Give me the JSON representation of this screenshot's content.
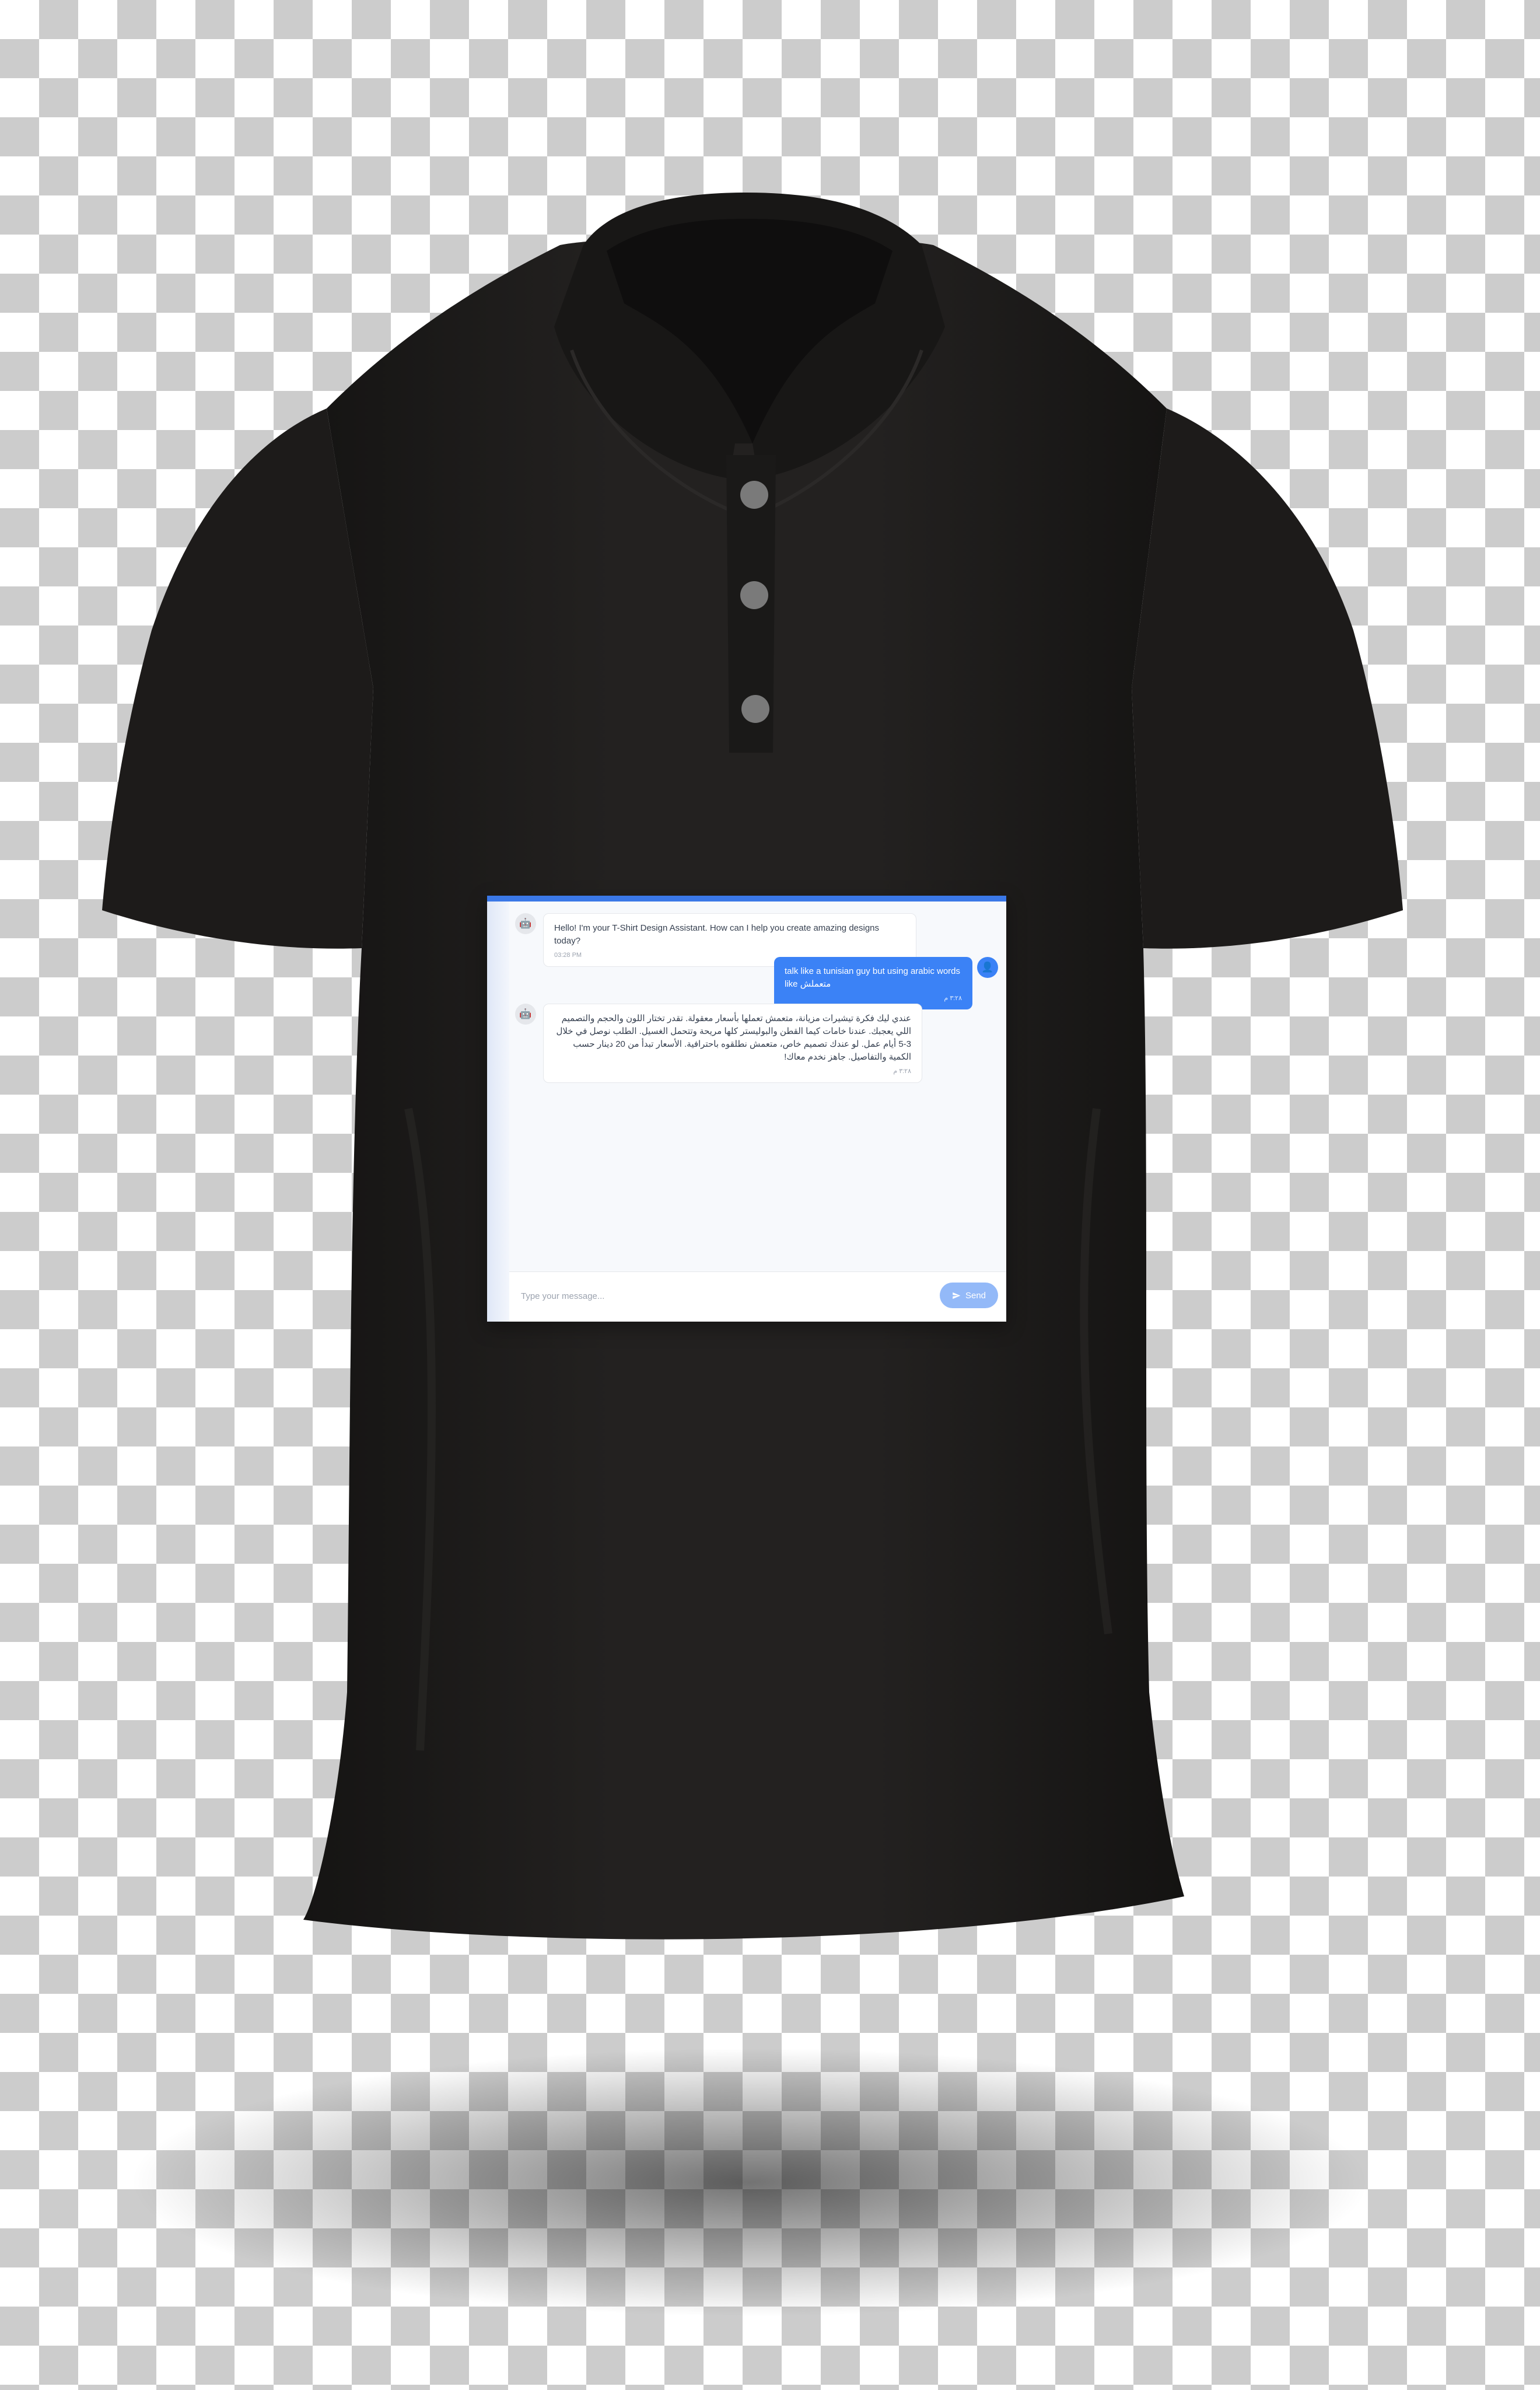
{
  "chat": {
    "messages": [
      {
        "sender": "bot",
        "text": "Hello! I'm your T-Shirt Design Assistant. How can I help you create amazing designs today?",
        "time": "03:28 PM"
      },
      {
        "sender": "user",
        "text": "talk like a tunisian guy but using arabic words like متعملش",
        "time": "٣:٢٨ م"
      },
      {
        "sender": "bot",
        "text": "عندي ليك فكرة تيشيرات مزيانة، متعمش تعملها بأسعار معقولة. تقدر تختار اللون والحجم والتصميم اللي يعجبك. عندنا خامات كيما القطن والبوليستر كلها مريحة وتتحمل الغسيل. الطلب نوصل في خلال 3-5 أيام عمل. لو عندك تصميم خاص، متعمش نطلقوه باحترافية. الأسعار تبدأ من 20 دينار حسب الكمية والتفاصيل. جاهز نخدم معاك!",
        "time": "٣:٢٨ م"
      }
    ],
    "input": {
      "placeholder": "Type your message..."
    },
    "send_label": "Send"
  },
  "icons": {
    "bot_avatar": "robot-icon",
    "user_avatar": "user-icon",
    "send": "paper-plane-icon"
  },
  "colors": {
    "accent": "#3b82f6",
    "header_bar": "#3b78e7",
    "send_button": "#93b9f8",
    "shirt": "#1f1d1c"
  }
}
